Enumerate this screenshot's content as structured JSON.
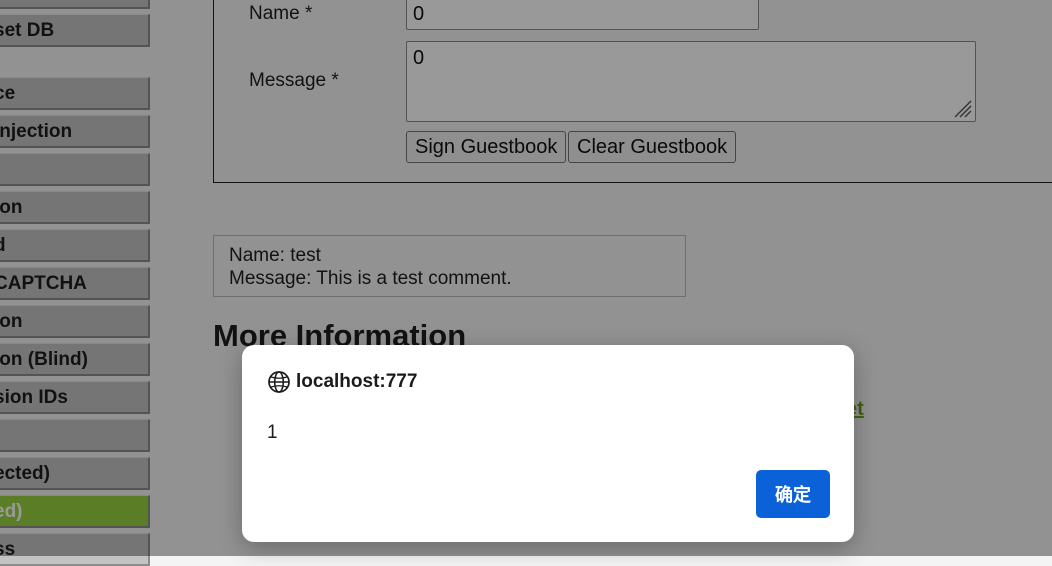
{
  "sidebar": {
    "items": [
      {
        "label": ""
      },
      {
        "label": "set DB"
      },
      {
        "label": "ce"
      },
      {
        "label": " Injection"
      },
      {
        "label": ""
      },
      {
        "label": "ion"
      },
      {
        "label": "d"
      },
      {
        "label": "CAPTCHA"
      },
      {
        "label": "ion"
      },
      {
        "label": "ion (Blind)"
      },
      {
        "label": "sion IDs"
      },
      {
        "label": ")"
      },
      {
        "label": "ected)"
      },
      {
        "label": "ed)"
      },
      {
        "label": "ss"
      }
    ]
  },
  "guestbook": {
    "name_label": "Name *",
    "name_value": "0",
    "message_label": "Message *",
    "message_value": "0",
    "sign_button": "Sign Guestbook",
    "clear_button": "Clear Guestbook"
  },
  "comment": {
    "name_line": "Name: test",
    "message_line": "Message: This is a test comment."
  },
  "more_info": {
    "heading": "More Information",
    "partial_link": "et"
  },
  "dialog": {
    "origin": "localhost:777",
    "message": "1",
    "ok_label": "确定",
    "ok_color": "#0b61d8"
  },
  "colors": {
    "active_nav": "#96d13e",
    "link": "#6a9d24"
  }
}
